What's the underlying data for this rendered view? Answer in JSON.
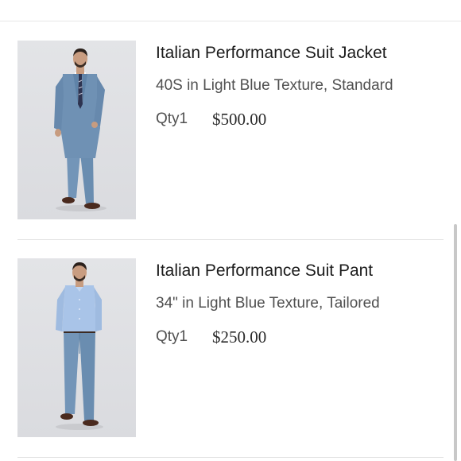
{
  "items": [
    {
      "title": "Italian Performance Suit Jacket",
      "variant": "40S in Light Blue Texture, Standard",
      "qty_label": "Qty1",
      "price": "$500.00",
      "image_icon": "suit-jacket-photo"
    },
    {
      "title": "Italian Performance Suit Pant",
      "variant": "34\" in Light Blue Texture, Tailored",
      "qty_label": "Qty1",
      "price": "$250.00",
      "image_icon": "suit-pant-photo"
    }
  ],
  "colors": {
    "suit_blue": "#6f91b4",
    "shirt_blue": "#a9c4e8",
    "thumb_bg": "#dedfe2",
    "divider": "#e3e3e3"
  }
}
